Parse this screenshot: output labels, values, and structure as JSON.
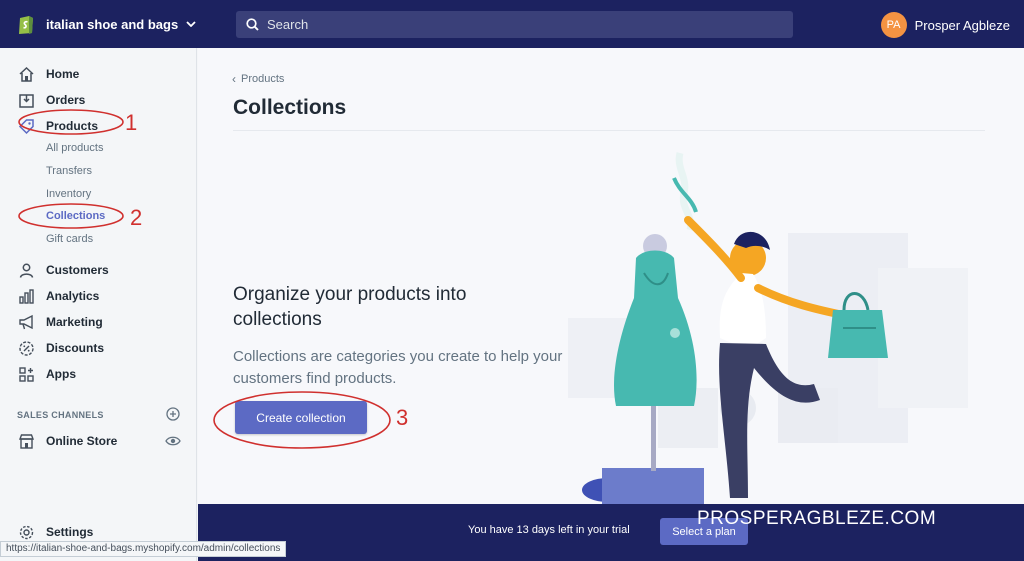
{
  "topbar": {
    "store_name": "italian shoe and bags",
    "search_placeholder": "Search",
    "user_initials": "PA",
    "user_name": "Prosper Agbleze"
  },
  "sidebar": {
    "items": [
      {
        "label": "Home",
        "icon": "home-icon"
      },
      {
        "label": "Orders",
        "icon": "orders-icon"
      },
      {
        "label": "Products",
        "icon": "tag-icon"
      },
      {
        "label": "Customers",
        "icon": "customers-icon"
      },
      {
        "label": "Analytics",
        "icon": "analytics-icon"
      },
      {
        "label": "Marketing",
        "icon": "marketing-icon"
      },
      {
        "label": "Discounts",
        "icon": "discounts-icon"
      },
      {
        "label": "Apps",
        "icon": "apps-icon"
      }
    ],
    "product_subitems": [
      "All products",
      "Transfers",
      "Inventory",
      "Collections",
      "Gift cards"
    ],
    "active_subitem": "Collections",
    "sales_channels_title": "SALES CHANNELS",
    "online_store": "Online Store",
    "settings": "Settings"
  },
  "main": {
    "breadcrumb": "Products",
    "title": "Collections",
    "empty_heading": "Organize your products into collections",
    "empty_body": "Collections are categories you create to help your customers find products.",
    "create_button": "Create collection"
  },
  "annotations": [
    "1",
    "2",
    "3"
  ],
  "trial": {
    "text": "You have 13 days left in your trial",
    "plan_button": "Select a plan"
  },
  "watermark": "PROSPERAGBLEZE.COM",
  "status_url": "https://italian-shoe-and-bags.myshopify.com/admin/collections",
  "colors": {
    "topbar": "#1c2260",
    "accent": "#5c6ac4",
    "annotation": "#d0302e"
  }
}
